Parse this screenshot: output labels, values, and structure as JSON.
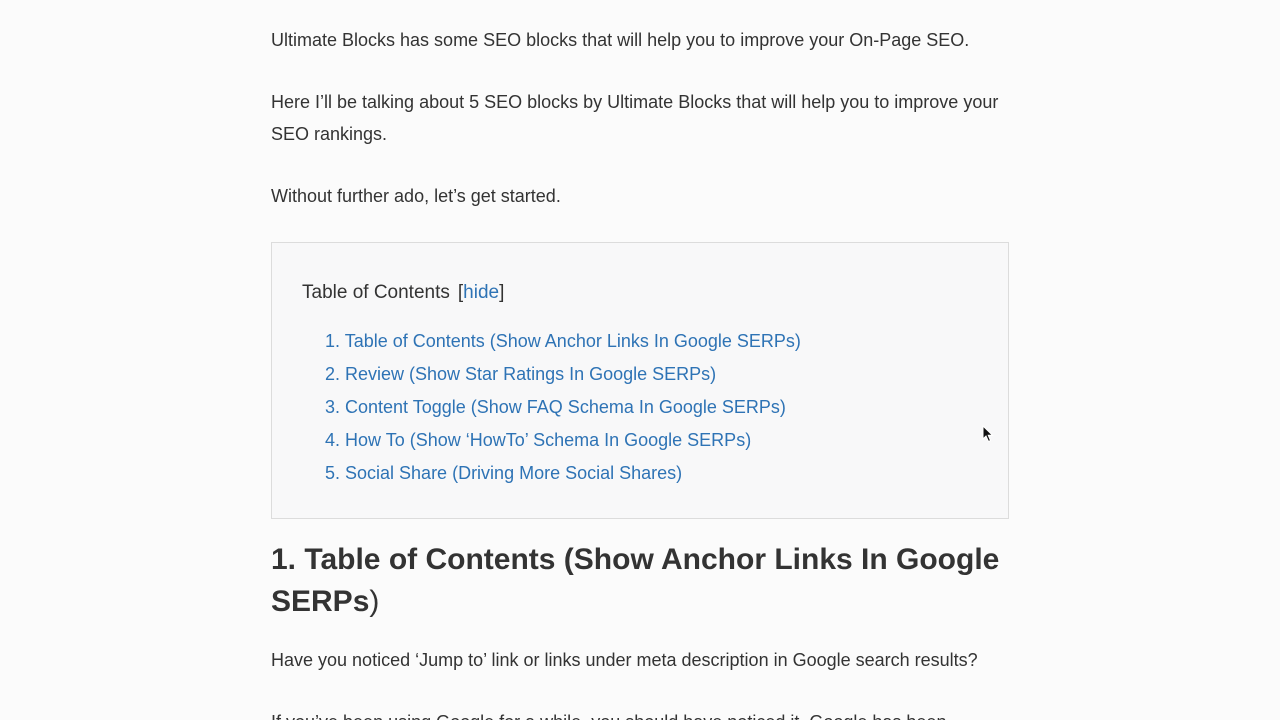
{
  "article": {
    "intro_1": "Ultimate Blocks has some SEO blocks that will help you to improve your On-Page SEO.",
    "intro_2": "Here I’ll be talking about 5 SEO blocks by Ultimate Blocks that will help you to improve your SEO rankings.",
    "intro_3": "Without further ado, let’s get started.",
    "toc": {
      "title": "Table of Contents",
      "toggle_open_bracket": "[",
      "toggle_label": "hide",
      "toggle_close_bracket": "]",
      "items": [
        "1. Table of Contents (Show Anchor Links In Google SERPs)",
        "2. Review (Show Star Ratings In Google SERPs)",
        "3. Content Toggle (Show FAQ Schema In Google SERPs)",
        "4. How To (Show ‘HowTo’ Schema In Google SERPs)",
        "5. Social Share (Driving More Social Shares)"
      ]
    },
    "section_1": {
      "heading": "1. Table of Contents (Show Anchor Links In Google SERPs",
      "heading_close": ")",
      "para_1": "Have you noticed  ‘Jump to’ link or links under meta description in Google search results?",
      "para_2": "If you’ve been using Google for a while, you should have noticed it. Google has been"
    }
  },
  "colors": {
    "text": "#333333",
    "link": "#2e73b5",
    "toc_background": "#f8f8f9",
    "toc_border": "#dcdcdc",
    "page_background": "#fbfbfb"
  },
  "icons": {
    "cursor": "mouse-pointer-icon"
  }
}
